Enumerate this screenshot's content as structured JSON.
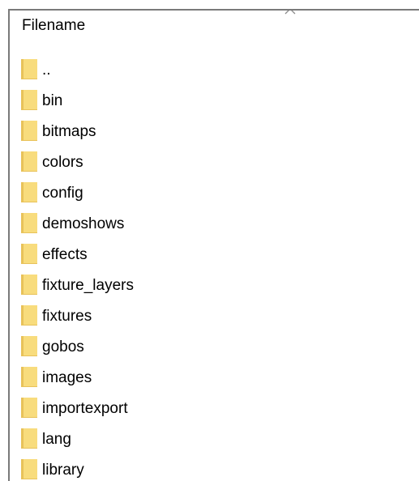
{
  "header": {
    "column_title": "Filename",
    "sort_indicator_icon": "chevron-up-icon"
  },
  "files": [
    {
      "name": "..",
      "icon": "folder-icon"
    },
    {
      "name": "bin",
      "icon": "folder-icon"
    },
    {
      "name": "bitmaps",
      "icon": "folder-icon"
    },
    {
      "name": "colors",
      "icon": "folder-icon"
    },
    {
      "name": "config",
      "icon": "folder-icon"
    },
    {
      "name": "demoshows",
      "icon": "folder-icon"
    },
    {
      "name": "effects",
      "icon": "folder-icon"
    },
    {
      "name": "fixture_layers",
      "icon": "folder-icon"
    },
    {
      "name": "fixtures",
      "icon": "folder-icon"
    },
    {
      "name": "gobos",
      "icon": "folder-icon"
    },
    {
      "name": "images",
      "icon": "folder-icon"
    },
    {
      "name": "importexport",
      "icon": "folder-icon"
    },
    {
      "name": "lang",
      "icon": "folder-icon"
    },
    {
      "name": "library",
      "icon": "folder-icon"
    }
  ],
  "colors": {
    "folder_fill": "#f8dc7d",
    "folder_dark": "#e8c25a",
    "border": "#7a7a7a"
  }
}
